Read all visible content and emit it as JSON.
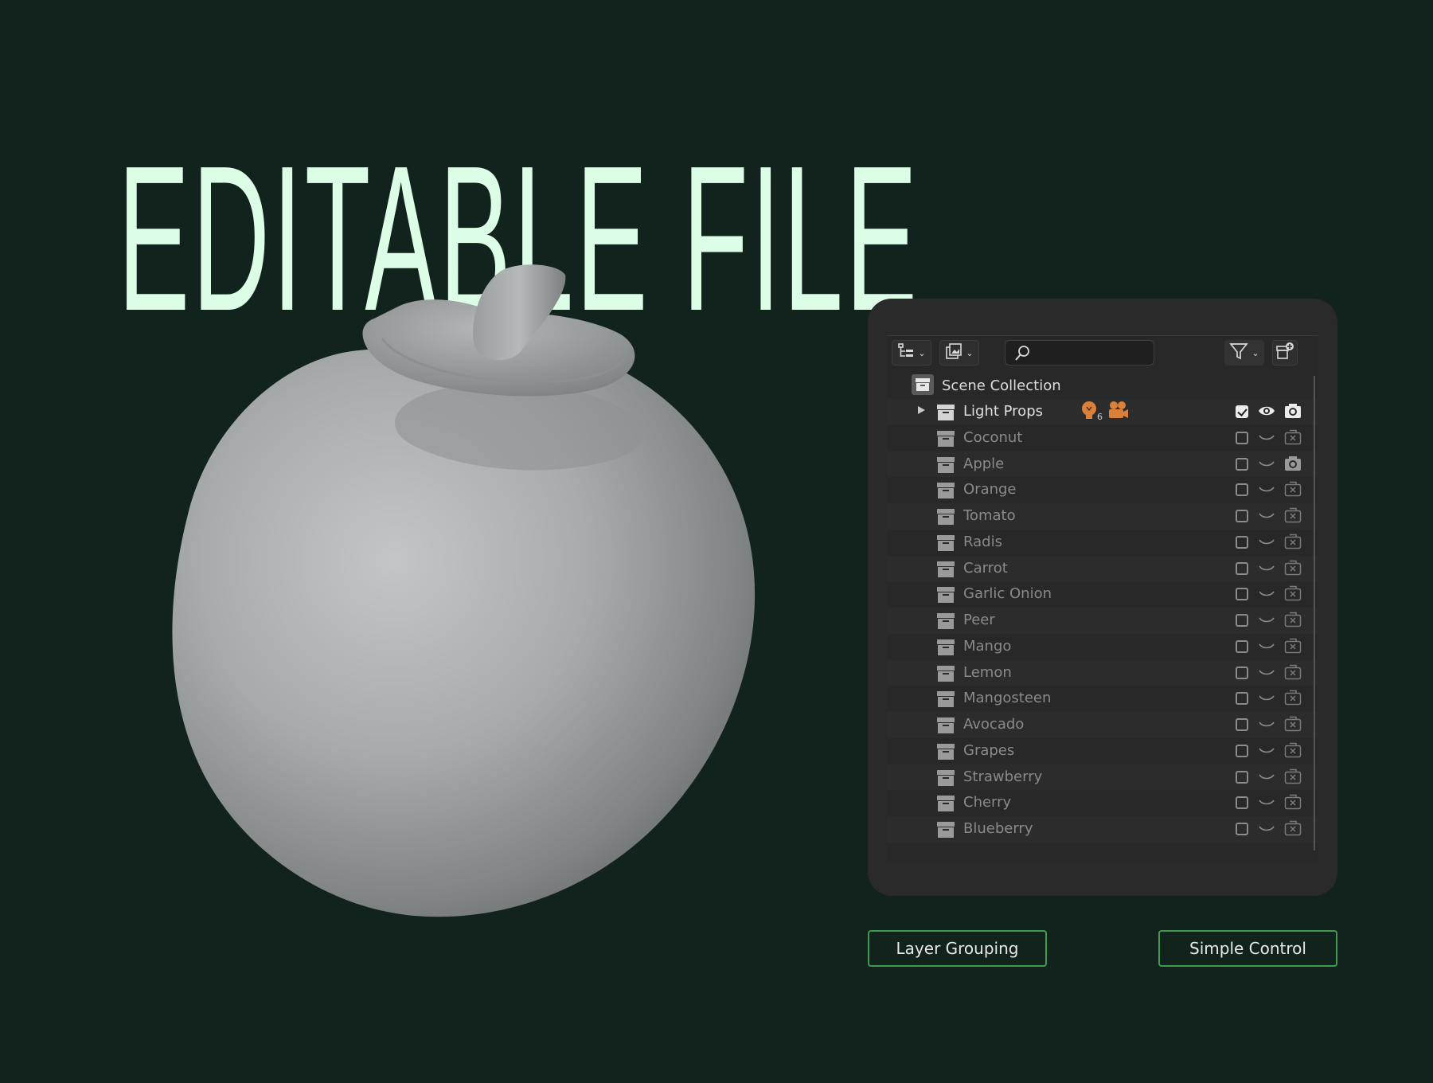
{
  "headline": "EDITABLE FILE",
  "outliner": {
    "search_placeholder": "",
    "scene_collection": "Scene Collection",
    "light_props": {
      "label": "Light Props",
      "badge_count": "6"
    },
    "items": [
      {
        "label": "Coconut",
        "render": "disabled"
      },
      {
        "label": "Apple",
        "render": "enabled"
      },
      {
        "label": "Orange",
        "render": "disabled"
      },
      {
        "label": "Tomato",
        "render": "disabled"
      },
      {
        "label": "Radis",
        "render": "disabled"
      },
      {
        "label": "Carrot",
        "render": "disabled"
      },
      {
        "label": "Garlic Onion",
        "render": "disabled"
      },
      {
        "label": "Peer",
        "render": "disabled"
      },
      {
        "label": "Mango",
        "render": "disabled"
      },
      {
        "label": "Lemon",
        "render": "disabled"
      },
      {
        "label": "Mangosteen",
        "render": "disabled"
      },
      {
        "label": "Avocado",
        "render": "disabled"
      },
      {
        "label": "Grapes",
        "render": "disabled"
      },
      {
        "label": "Strawberry",
        "render": "disabled"
      },
      {
        "label": "Cherry",
        "render": "disabled"
      },
      {
        "label": "Blueberry",
        "render": "disabled"
      }
    ]
  },
  "buttons": {
    "layer_grouping": "Layer Grouping",
    "simple_control": "Simple Control"
  },
  "colors": {
    "background": "#12231d",
    "headline": "#dcfde6",
    "accent_border": "#3f9a4d",
    "badge_orange": "#d9803a"
  },
  "icons": [
    "collection-icon",
    "outliner-display-mode-icon",
    "view-layer-icon",
    "search-icon",
    "filter-icon",
    "new-collection-icon",
    "light-icon",
    "camera-object-icon",
    "eye-icon",
    "hidden-eye-icon",
    "render-camera-icon",
    "render-disabled-icon"
  ]
}
